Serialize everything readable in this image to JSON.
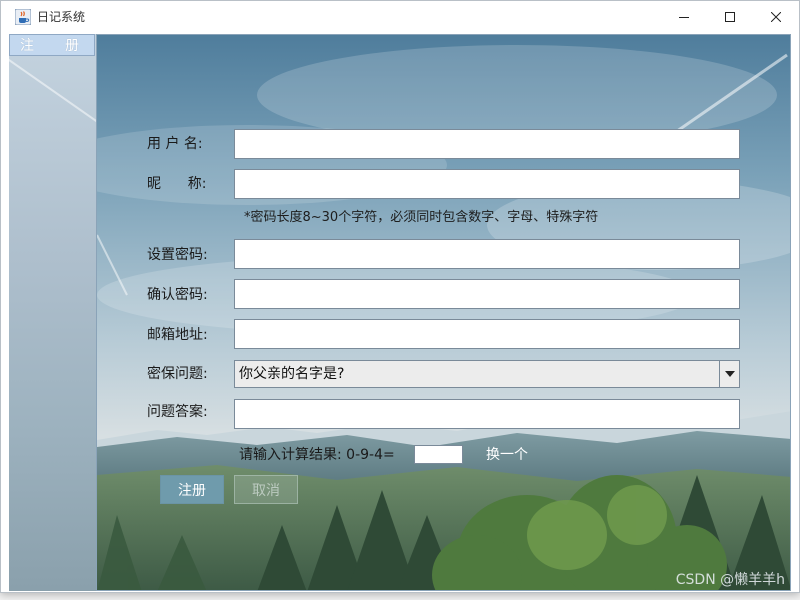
{
  "window": {
    "title": "日记系统"
  },
  "sidebar": {
    "tab_label": "注　　册"
  },
  "form": {
    "username_label": "用 户 名:",
    "nickname_label": "昵      称:",
    "password_hint": "*密码长度8~30个字符，必须同时包含数字、字母、特殊字符",
    "password_label": "设置密码:",
    "confirm_label": "确认密码:",
    "email_label": "邮箱地址:",
    "question_label": "密保问题:",
    "question_selected": "你父亲的名字是?",
    "answer_label": "问题答案:",
    "username_value": "",
    "nickname_value": "",
    "password_value": "",
    "confirm_value": "",
    "email_value": "",
    "answer_value": ""
  },
  "captcha": {
    "label": "请输入计算结果:  0-9-4=",
    "value": "",
    "change_label": "换一个"
  },
  "buttons": {
    "register_label": "注册",
    "cancel_label": "取消"
  },
  "watermark": "CSDN @懒羊羊h",
  "colors": {
    "accent_button": "#6f9bac",
    "tab_background": "#c3d8ef"
  },
  "icons": {
    "app": "java-cup-icon",
    "minimize": "minimize-icon",
    "maximize": "maximize-icon",
    "close": "close-icon",
    "dropdown": "chevron-down-icon"
  }
}
